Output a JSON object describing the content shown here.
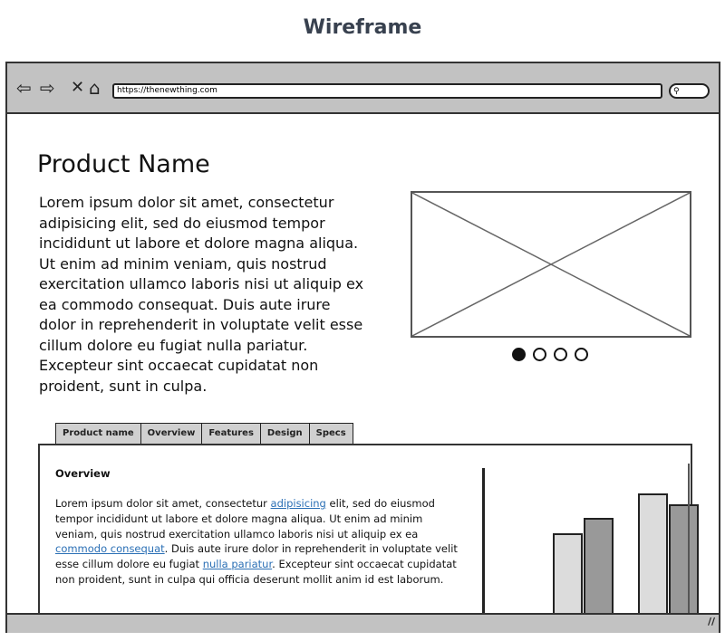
{
  "title": "Wireframe",
  "browser": {
    "url": "https://thenewthing.com",
    "search_icon": "search-icon",
    "nav_icons": [
      "back-arrow-icon",
      "forward-arrow-icon",
      "close-icon",
      "home-icon"
    ]
  },
  "product": {
    "name": "Product Name",
    "description": "Lorem ipsum dolor sit amet, consectetur adipisicing elit, sed do eiusmod tempor incididunt ut labore et dolore magna aliqua. Ut enim ad minim veniam, quis nostrud exercitation ullamco laboris nisi ut aliquip ex ea commodo consequat. Duis aute irure dolor in reprehenderit in voluptate velit esse cillum dolore eu fugiat nulla pariatur. Excepteur sint occaecat cupidatat non proident, sunt in culpa."
  },
  "carousel": {
    "count": 4,
    "active": 0
  },
  "tabs": [
    "Product name",
    "Overview",
    "Features",
    "Design",
    "Specs"
  ],
  "overview": {
    "heading": "Overview",
    "t1": "Lorem ipsum dolor sit amet, consectetur ",
    "l1": "adipisicing",
    "t2": " elit, sed do eiusmod tempor incididunt ut labore et dolore magna aliqua. Ut enim ad minim veniam, quis nostrud exercitation ullamco laboris nisi ut aliquip ex ea ",
    "l2": "commodo consequat",
    "t3": ". Duis aute irure dolor in reprehenderit in voluptate velit esse cillum dolore eu fugiat ",
    "l3": "nulla pariatur",
    "t4": ". Excepteur sint occaecat cupidatat non proident, sunt in culpa qui officia deserunt mollit anim id est laborum."
  },
  "chart_data": {
    "type": "bar",
    "series": [
      {
        "values": [
          93,
          137
        ]
      },
      {
        "values": [
          110,
          125
        ]
      }
    ],
    "colors": [
      "#dcdcdc",
      "#999999"
    ]
  }
}
